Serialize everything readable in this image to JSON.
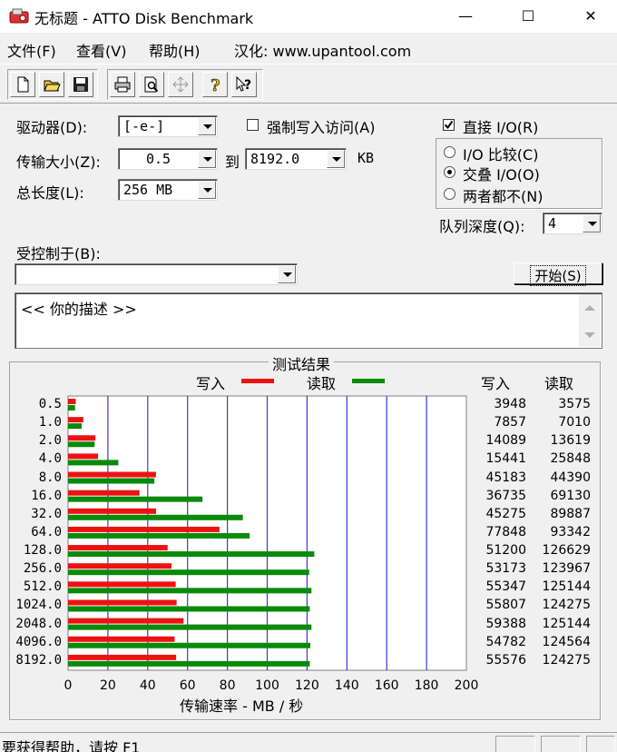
{
  "window": {
    "title": "无标题 - ATTO Disk Benchmark",
    "min": "—",
    "max": "☐",
    "close": "✕"
  },
  "menu": {
    "file": "文件(F)",
    "view": "查看(V)",
    "help": "帮助(H)",
    "localized": "汉化: www.upantool.com"
  },
  "toolbar": {
    "icons": [
      "new-icon",
      "open-icon",
      "save-icon",
      "print-icon",
      "print-preview-icon",
      "move-icon",
      "help-icon",
      "context-help-icon"
    ]
  },
  "settings": {
    "drive_label": "驱动器(D):",
    "drive_value": "[-e-]",
    "force_write_label": "强制写入访问(A)",
    "direct_io_label": "直接 I/O(R)",
    "transfer_label": "传输大小(Z):",
    "transfer_from": "0.5",
    "to_label": "到",
    "transfer_to": "8192.0",
    "kb_label": "KB",
    "total_label": "总长度(L):",
    "total_value": "256 MB",
    "io_compare_label": "I/O 比较(C)",
    "overlap_label": "交叠 I/O(O)",
    "neither_label": "两者都不(N)",
    "queue_label": "队列深度(Q):",
    "queue_value": "4",
    "controlled_label": "受控制于(B):",
    "controlled_value": "",
    "start_button": "开始(S)",
    "description": "<<   你的描述   >>"
  },
  "results": {
    "title": "测试结果",
    "write_label": "写入",
    "read_label": "读取",
    "write_head": "写入",
    "read_head": "读取",
    "xlabel": "传输速率 - MB / 秒"
  },
  "status": {
    "text": "要获得帮助，请按 F1"
  },
  "colors": {
    "write": "#ee1111",
    "read": "#0a8a0a",
    "grid": "#3a3ad6"
  },
  "chart_data": {
    "type": "bar",
    "orientation": "horizontal",
    "categories": [
      "0.5",
      "1.0",
      "2.0",
      "4.0",
      "8.0",
      "16.0",
      "32.0",
      "64.0",
      "128.0",
      "256.0",
      "512.0",
      "1024.0",
      "2048.0",
      "4096.0",
      "8192.0"
    ],
    "series": [
      {
        "name": "写入",
        "values": [
          3948,
          7857,
          14089,
          15441,
          45183,
          36735,
          45275,
          77848,
          51200,
          53173,
          55347,
          55807,
          59388,
          54782,
          55576
        ]
      },
      {
        "name": "读取",
        "values": [
          3575,
          7010,
          13619,
          25848,
          44390,
          69130,
          89887,
          93342,
          126629,
          123967,
          125144,
          124275,
          125144,
          124564,
          124275
        ]
      }
    ],
    "xlabel": "传输速率 - MB / 秒",
    "xlim": [
      0,
      200
    ],
    "xticks": [
      "0",
      "20",
      "40",
      "60",
      "80",
      "100",
      "120",
      "140",
      "160",
      "180",
      "200"
    ],
    "grid": true
  }
}
